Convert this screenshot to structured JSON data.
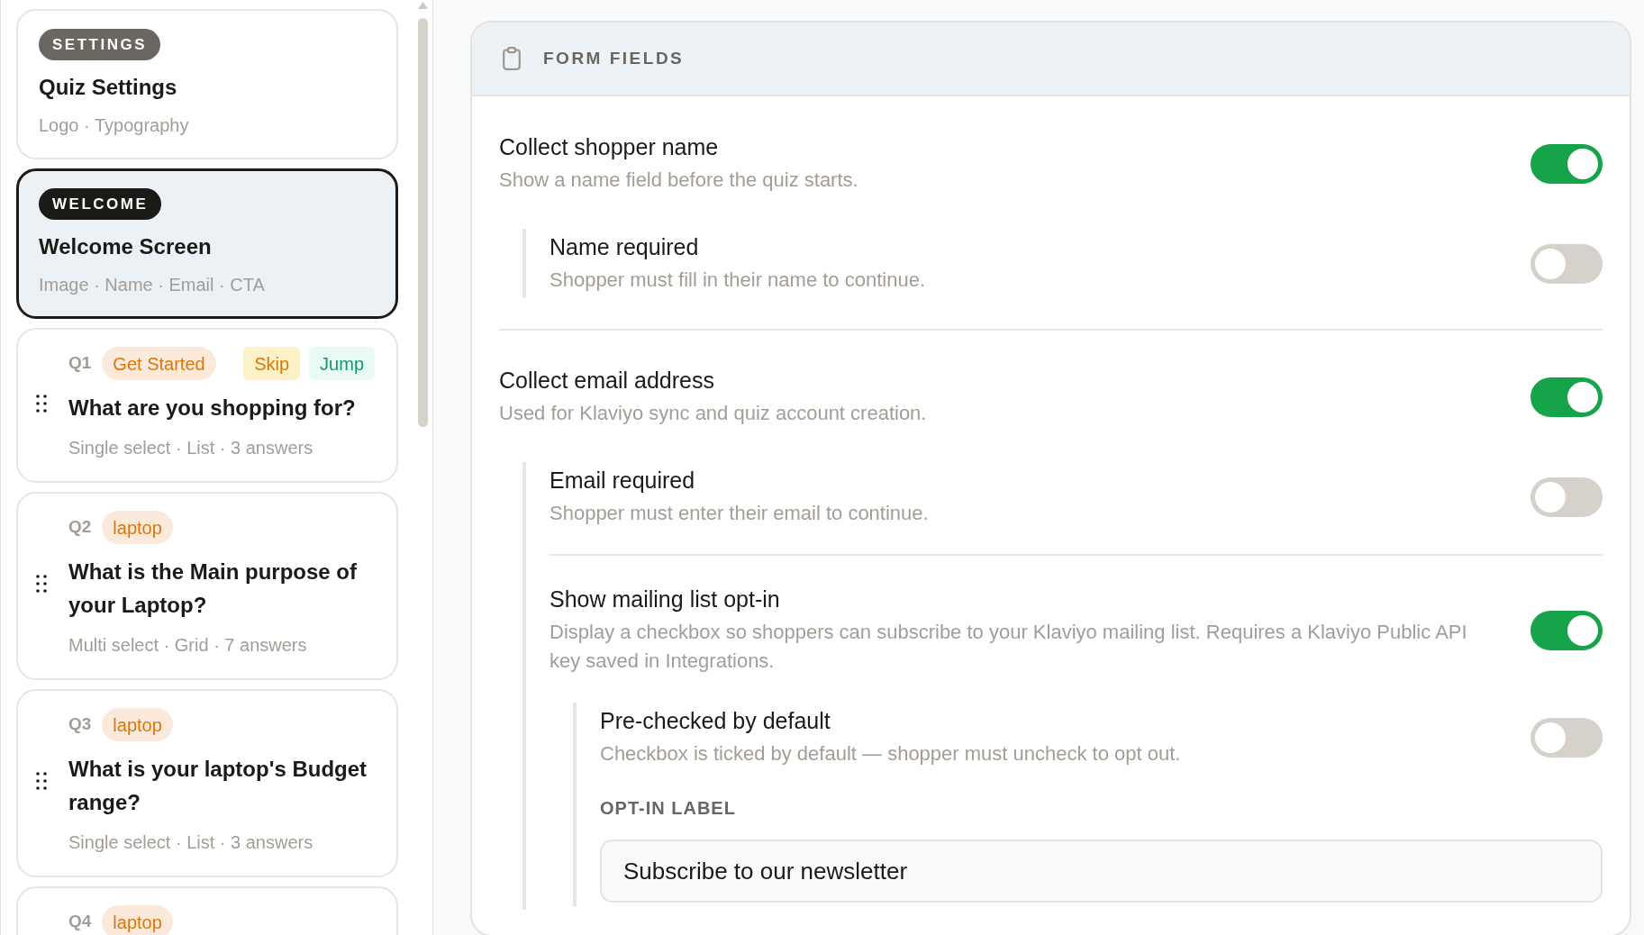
{
  "sidebar": {
    "cards": [
      {
        "kind": "section",
        "badge": "SETTINGS",
        "title": "Quiz Settings",
        "subtitle": "Logo · Typography",
        "selected": false
      },
      {
        "kind": "section",
        "badge": "WELCOME",
        "title": "Welcome Screen",
        "subtitle": "Image · Name · Email · CTA",
        "selected": true
      },
      {
        "kind": "question",
        "number": "Q1",
        "tags": [
          {
            "label": "Get Started",
            "kind": "topic"
          },
          {
            "label": "Skip",
            "kind": "skip"
          },
          {
            "label": "Jump",
            "kind": "jump"
          }
        ],
        "title": "What are you shopping for?",
        "meta": "Single select · List · 3 answers",
        "selected": false
      },
      {
        "kind": "question",
        "number": "Q2",
        "tags": [
          {
            "label": "laptop",
            "kind": "topic"
          }
        ],
        "title": "What is the Main purpose of your Laptop?",
        "meta": "Multi select · Grid · 7 answers",
        "selected": false
      },
      {
        "kind": "question",
        "number": "Q3",
        "tags": [
          {
            "label": "laptop",
            "kind": "topic"
          }
        ],
        "title": "What is your laptop's Budget range?",
        "meta": "Single select · List · 3 answers",
        "selected": false
      },
      {
        "kind": "question",
        "number": "Q4",
        "tags": [
          {
            "label": "laptop",
            "kind": "topic"
          }
        ],
        "selected": false
      }
    ]
  },
  "panel": {
    "title": "FORM FIELDS",
    "fields": [
      {
        "kind": "toggle",
        "title": "Collect shopper name",
        "description": "Show a name field before the quiz starts.",
        "on": true,
        "children": [
          {
            "kind": "toggle",
            "title": "Name required",
            "description": "Shopper must fill in their name to continue.",
            "on": false
          }
        ]
      },
      {
        "kind": "toggle",
        "title": "Collect email address",
        "description": "Used for Klaviyo sync and quiz account creation.",
        "on": true,
        "children": [
          {
            "kind": "toggle",
            "title": "Email required",
            "description": "Shopper must enter their email to continue.",
            "on": false
          },
          {
            "kind": "toggle",
            "title": "Show mailing list opt-in",
            "description": "Display a checkbox so shoppers can subscribe to your Klaviyo mailing list. Requires a Klaviyo Public API key saved in Integrations.",
            "on": true,
            "children": [
              {
                "kind": "toggle",
                "title": "Pre-checked by default",
                "description": "Checkbox is ticked by default — shopper must uncheck to opt out.",
                "on": false
              },
              {
                "kind": "text",
                "label": "OPT-IN LABEL",
                "value": "Subscribe to our newsletter"
              }
            ]
          }
        ]
      }
    ]
  }
}
